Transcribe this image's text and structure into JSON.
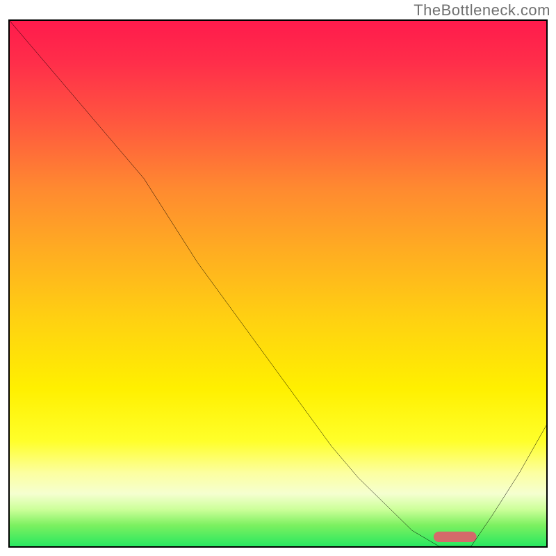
{
  "watermark": "TheBottleneck.com",
  "chart_data": {
    "type": "line",
    "title": "",
    "xlabel": "",
    "ylabel": "",
    "xlim": [
      0,
      100
    ],
    "ylim": [
      0,
      100
    ],
    "x": [
      0,
      5,
      10,
      15,
      20,
      25,
      30,
      35,
      40,
      45,
      50,
      55,
      60,
      65,
      70,
      75,
      80,
      82,
      86,
      90,
      95,
      100
    ],
    "y": [
      100,
      94,
      88,
      82,
      76,
      70,
      62,
      54,
      47,
      40,
      33,
      26,
      19,
      13,
      8,
      3,
      0,
      0,
      0,
      6,
      14,
      23
    ],
    "optimal_marker": {
      "x_start": 79,
      "x_end": 87,
      "y": 0
    },
    "background_gradient": {
      "orientation": "vertical",
      "stops": [
        {
          "pos": 0,
          "color": "#ff1b4c"
        },
        {
          "pos": 20,
          "color": "#ff5a3e"
        },
        {
          "pos": 45,
          "color": "#ffb020"
        },
        {
          "pos": 70,
          "color": "#fff000"
        },
        {
          "pos": 90,
          "color": "#f5ffd0"
        },
        {
          "pos": 100,
          "color": "#28e860"
        }
      ]
    }
  }
}
